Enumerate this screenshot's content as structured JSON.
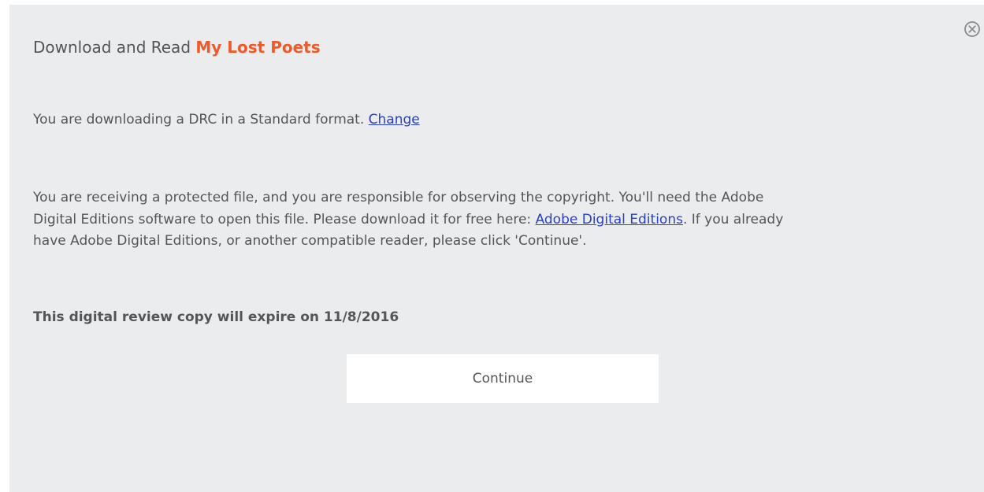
{
  "dialog": {
    "title_prefix": "Download and Read ",
    "book_title": "My Lost Poets",
    "close_icon": "close-circle-icon",
    "accent_color": "#f05a28",
    "format_text": "You are downloading a DRC in a Standard format. ",
    "format_change_link": "Change",
    "notice_part1": "You are receiving a protected file, and you are responsible for observing the copyright. You'll need the Adobe Digital Editions software to open this file. Please download it for free here: ",
    "notice_link": "Adobe Digital Editions",
    "notice_part2": ". If you already have Adobe Digital Editions, or another compatible reader, please click 'Continue'.",
    "expiry_text": "This digital review copy will expire on 11/8/2016",
    "continue_label": "Continue"
  }
}
